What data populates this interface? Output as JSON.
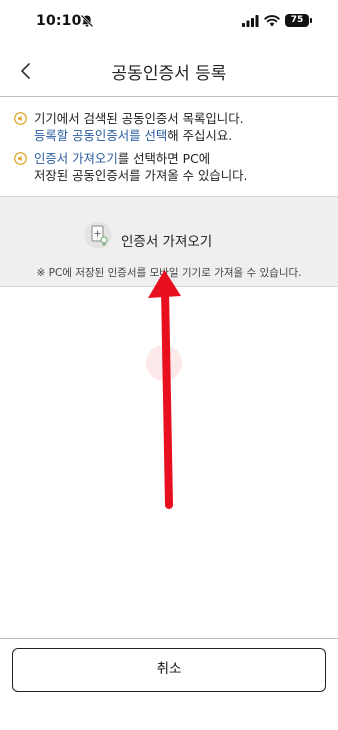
{
  "status_bar": {
    "time": "10:10",
    "battery_level": "75"
  },
  "header": {
    "title": "공동인증서 등록"
  },
  "notices": {
    "line1_a": "기기에서 검색된 공동인증서 목록입니다.",
    "line1_link": "등록할 공동인증서를 선택",
    "line1_b": "해 주십시요.",
    "line2_link": "인증서 가져오기",
    "line2_a": "를 선택하면 PC에",
    "line2_b": "저장된 공동인증서를 가져올 수 있습니다."
  },
  "import_panel": {
    "label": "인증서 가져오기",
    "note": "※ PC에 저장된 인증서를 모바일 기기로 가져올 수 있습니다."
  },
  "footer": {
    "cancel_label": "취소"
  },
  "colors": {
    "link": "#2a5d9f",
    "notice_icon": "#e0a21f",
    "annotation_arrow": "#e8101e",
    "panel_bg": "#efefef"
  }
}
